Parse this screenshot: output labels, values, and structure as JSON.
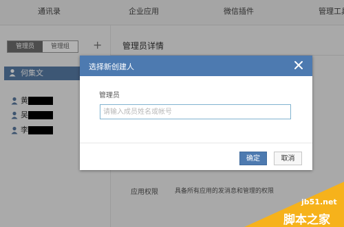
{
  "nav": {
    "tabs": [
      {
        "label": "通讯录"
      },
      {
        "label": "企业应用"
      },
      {
        "label": "微信插件"
      },
      {
        "label": "管理工具"
      }
    ]
  },
  "left_panel": {
    "segment": {
      "active": "管理员",
      "inactive": "管理组"
    },
    "add_symbol": "+",
    "selected_user": "何集文",
    "members": [
      {
        "initial": "黄"
      },
      {
        "initial": "吴"
      },
      {
        "initial": "李"
      }
    ]
  },
  "detail": {
    "title": "管理员详情",
    "perm_label": "应用权限",
    "perm_text": "具备所有应用的发消息和管理的权限"
  },
  "modal": {
    "title": "选择新创建人",
    "close_symbol": "×",
    "field_label": "管理员",
    "input_value": "",
    "input_placeholder": "请输入成员姓名或帐号",
    "ok_label": "确定",
    "cancel_label": "取消"
  },
  "watermark": {
    "site": "jb51.net",
    "name": "脚本之家"
  },
  "colors": {
    "accent": "#4d7ab0",
    "selected_user_bg": "#587da8",
    "watermark": "#f6b21b"
  }
}
